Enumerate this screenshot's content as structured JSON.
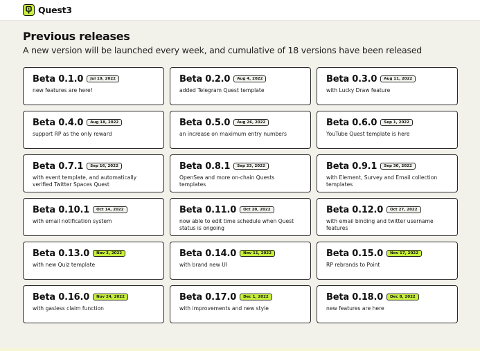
{
  "app": {
    "name": "Quest3"
  },
  "header": {
    "title": "Previous releases",
    "subtitle": "A new version will be launched every week, and cumulative of 18 versions have been released"
  },
  "colors": {
    "accent": "#c8f03c",
    "background": "#f2f1ea",
    "card": "#ffffff",
    "border": "#2a2a2a"
  },
  "releases": [
    {
      "version": "Beta 0.1.0",
      "date": "Jul 19, 2022",
      "desc": "new features are here!",
      "highlight": false
    },
    {
      "version": "Beta 0.2.0",
      "date": "Aug 4, 2022",
      "desc": "added Telegram Quest template",
      "highlight": false
    },
    {
      "version": "Beta 0.3.0",
      "date": "Aug 11, 2022",
      "desc": "with Lucky Draw feature",
      "highlight": false
    },
    {
      "version": "Beta 0.4.0",
      "date": "Aug 18, 2022",
      "desc": "support RP as the only reward",
      "highlight": false
    },
    {
      "version": "Beta 0.5.0",
      "date": "Aug 26, 2022",
      "desc": "an increase on maximum entry numbers",
      "highlight": false
    },
    {
      "version": "Beta 0.6.0",
      "date": "Sep 1, 2022",
      "desc": "YouTube Quest template is here",
      "highlight": false
    },
    {
      "version": "Beta 0.7.1",
      "date": "Sep 16, 2022",
      "desc": "with event template, and automatically verified Twitter Spaces Quest",
      "highlight": false
    },
    {
      "version": "Beta 0.8.1",
      "date": "Sep 23, 2022",
      "desc": "OpenSea and more on-chain Quests templates",
      "highlight": false
    },
    {
      "version": "Beta 0.9.1",
      "date": "Sep 30, 2022",
      "desc": "with Element, Survey and Email collection templates",
      "highlight": false
    },
    {
      "version": "Beta 0.10.1",
      "date": "Oct 14, 2022",
      "desc": "with email notification system",
      "highlight": false
    },
    {
      "version": "Beta 0.11.0",
      "date": "Oct 20, 2022",
      "desc": "now able to edit time schedule when Quest status is ongoing",
      "highlight": false
    },
    {
      "version": "Beta 0.12.0",
      "date": "Oct 27, 2022",
      "desc": "with email binding and twitter username features",
      "highlight": false
    },
    {
      "version": "Beta 0.13.0",
      "date": "Nov 3, 2022",
      "desc": "with new Quiz template",
      "highlight": true
    },
    {
      "version": "Beta 0.14.0",
      "date": "Nov 11, 2022",
      "desc": "with brand new UI",
      "highlight": true
    },
    {
      "version": "Beta 0.15.0",
      "date": "Nov 17, 2022",
      "desc": "RP rebrands to Point",
      "highlight": true
    },
    {
      "version": "Beta 0.16.0",
      "date": "Nov 24, 2022",
      "desc": "with gasless claim function",
      "highlight": true
    },
    {
      "version": "Beta 0.17.0",
      "date": "Dec 1, 2022",
      "desc": "with improvements and new style",
      "highlight": true
    },
    {
      "version": "Beta 0.18.0",
      "date": "Dec 8, 2022",
      "desc": "new features are here",
      "highlight": true
    }
  ]
}
